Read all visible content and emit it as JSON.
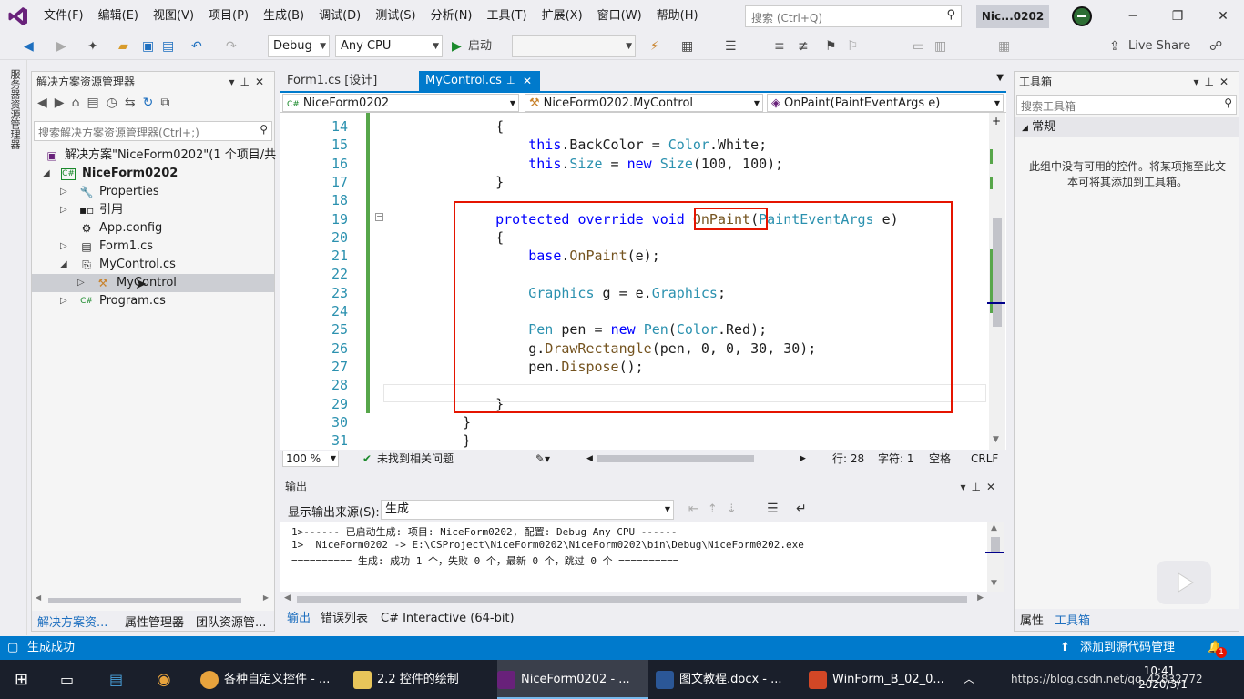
{
  "menubar": {
    "items": [
      "文件(F)",
      "编辑(E)",
      "视图(V)",
      "项目(P)",
      "生成(B)",
      "调试(D)",
      "测试(S)",
      "分析(N)",
      "工具(T)",
      "扩展(X)",
      "窗口(W)",
      "帮助(H)"
    ],
    "search_placeholder": "搜索 (Ctrl+Q)",
    "solution_title": "Nic...0202"
  },
  "toolbar": {
    "config": "Debug",
    "platform": "Any CPU",
    "start_label": "启动",
    "live_share": "Live Share"
  },
  "leftstrip": {
    "label": "服务器资源管理器"
  },
  "solution_explorer": {
    "title": "解决方案资源管理器",
    "search_placeholder": "搜索解决方案资源管理器(Ctrl+;)",
    "solution": "解决方案\"NiceForm0202\"(1 个项目/共",
    "project": "NiceForm0202",
    "items": {
      "properties": "Properties",
      "refs": "引用",
      "appconfig": "App.config",
      "form1": "Form1.cs",
      "mycontrol": "MyControl.cs",
      "mycontrol_class": "MyControl",
      "program": "Program.cs"
    },
    "tabs": [
      "解决方案资...",
      "属性管理器",
      "团队资源管..."
    ]
  },
  "editor": {
    "tabs": {
      "form1": "Form1.cs [设计]",
      "mycontrol": "MyControl.cs"
    },
    "nav": {
      "project": "NiceForm0202",
      "class": "NiceForm0202.MyControl",
      "member": "OnPaint(PaintEventArgs e)"
    },
    "lines": [
      {
        "n": "14",
        "ind": "    ",
        "t": "{"
      },
      {
        "n": "15",
        "ind": "        ",
        "t": "this.BackColor = Color.White;"
      },
      {
        "n": "16",
        "ind": "        ",
        "t": "this.Size = new Size(100, 100);"
      },
      {
        "n": "17",
        "ind": "    ",
        "t": "}"
      },
      {
        "n": "18",
        "ind": "",
        "t": ""
      },
      {
        "n": "19",
        "ind": "    ",
        "t": "protected override void OnPaint(PaintEventArgs e)"
      },
      {
        "n": "20",
        "ind": "    ",
        "t": "{"
      },
      {
        "n": "21",
        "ind": "        ",
        "t": "base.OnPaint(e);"
      },
      {
        "n": "22",
        "ind": "",
        "t": ""
      },
      {
        "n": "23",
        "ind": "        ",
        "t": "Graphics g = e.Graphics;"
      },
      {
        "n": "24",
        "ind": "",
        "t": ""
      },
      {
        "n": "25",
        "ind": "        ",
        "t": "Pen pen = new Pen(Color.Red);"
      },
      {
        "n": "26",
        "ind": "        ",
        "t": "g.DrawRectangle(pen, 0, 0, 30, 30);"
      },
      {
        "n": "27",
        "ind": "        ",
        "t": "pen.Dispose();"
      },
      {
        "n": "28",
        "ind": "",
        "t": ""
      },
      {
        "n": "29",
        "ind": "    ",
        "t": "}"
      },
      {
        "n": "30",
        "ind": "",
        "t": "}"
      },
      {
        "n": "31",
        "ind": "",
        "t": "}"
      }
    ],
    "status": {
      "zoom": "100 %",
      "issues": "未找到相关问题",
      "line": "行: 28",
      "col": "字符: 1",
      "spacing": "空格",
      "eol": "CRLF"
    }
  },
  "output": {
    "title": "输出",
    "source_label": "显示输出来源(S):",
    "source_value": "生成",
    "lines": [
      "1>------ 已启动生成: 项目: NiceForm0202, 配置: Debug Any CPU ------",
      "1>  NiceForm0202 -> E:\\CSProject\\NiceForm0202\\NiceForm0202\\bin\\Debug\\NiceForm0202.exe",
      "========== 生成: 成功 1 个，失败 0 个，最新 0 个，跳过 0 个 =========="
    ],
    "tabs": [
      "输出",
      "错误列表",
      "C# Interactive (64-bit)"
    ]
  },
  "toolbox": {
    "title": "工具箱",
    "search_placeholder": "搜索工具箱",
    "group": "常规",
    "empty_text": "此组中没有可用的控件。将某项拖至此文本可将其添加到工具箱。",
    "tabs": [
      "属性",
      "工具箱"
    ]
  },
  "statusbar": {
    "left": "生成成功",
    "right": "添加到源代码管理",
    "notif": "1"
  },
  "taskbar": {
    "items": [
      "各种自定义控件 - ...",
      "2.2 控件的绘制",
      "NiceForm0202 - ...",
      "图文教程.docx - ...",
      "WinForm_B_02_0..."
    ],
    "time": "10:41",
    "date": "2020/3/1",
    "watermark": "https://blog.csdn.net/qq_42832772"
  },
  "colors": {
    "accent": "#007acc",
    "highlight": "#e51400",
    "keyword": "#0000ff",
    "type": "#2b91af"
  }
}
